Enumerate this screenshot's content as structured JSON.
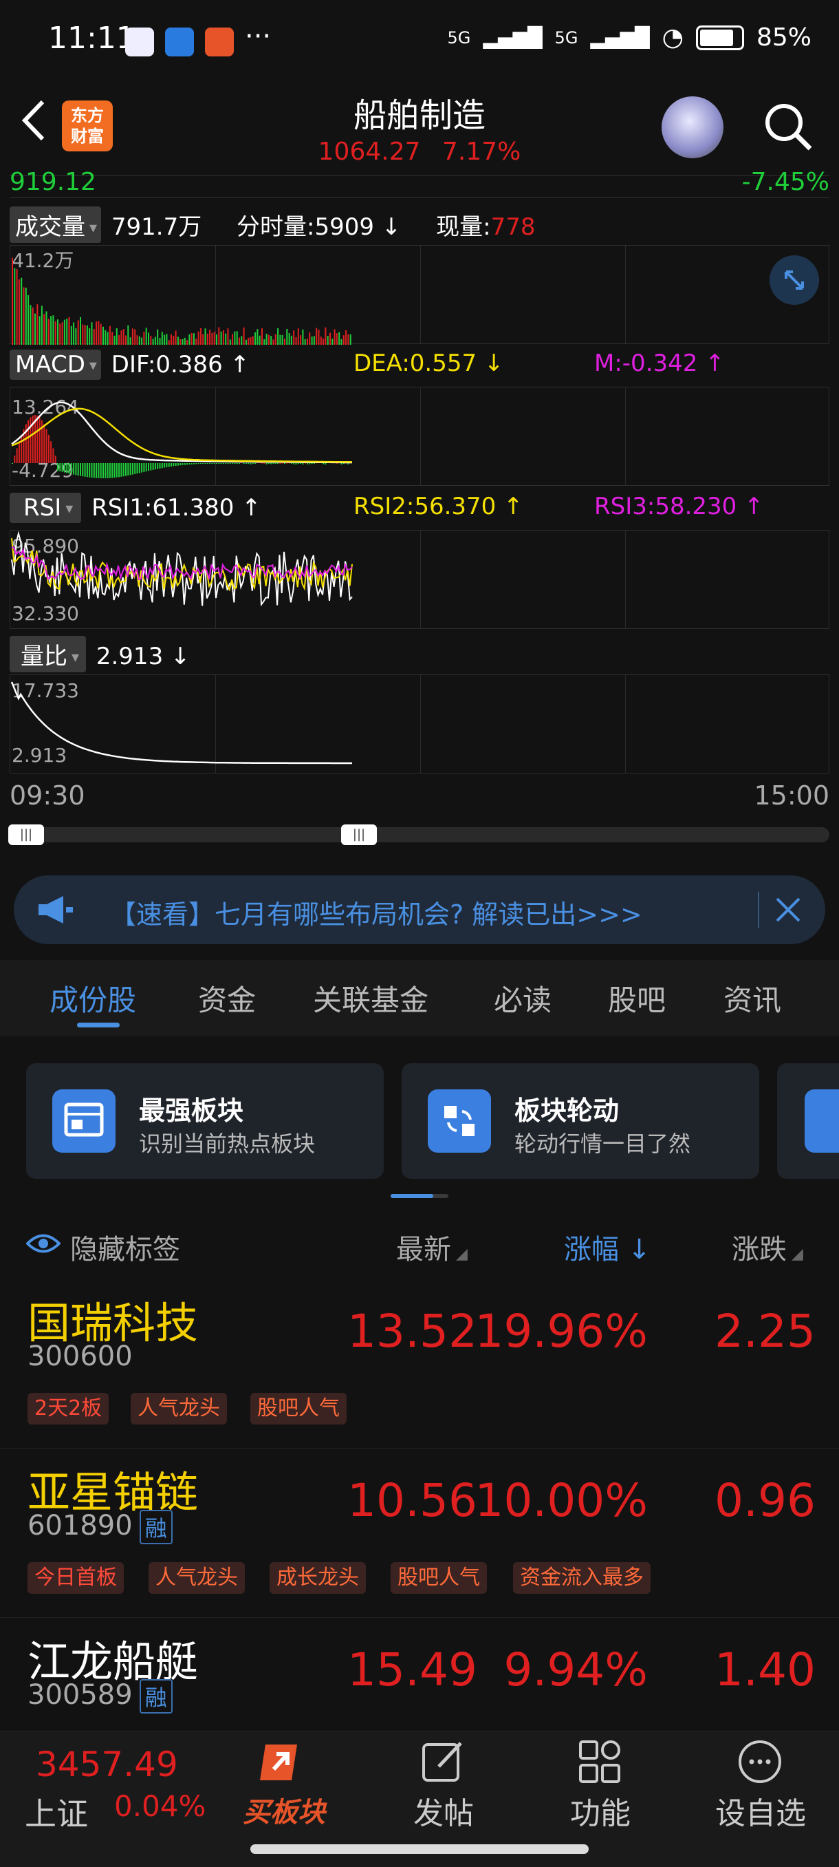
{
  "status": {
    "time": "11:11",
    "battery": "85%",
    "signal1": "5G",
    "signal2": "5G",
    "extra": "···"
  },
  "header": {
    "title": "船舶制造",
    "price": "1064.27",
    "change": "7.17%",
    "logo_text": "东方财富"
  },
  "chart": {
    "top_left_value": "919.12",
    "top_right_value": "-7.45%",
    "volume": {
      "selector": "成交量",
      "value": "791.7万",
      "minute_label": "分时量:5909",
      "minute_arrow": "↓",
      "now_label": "现量:",
      "now_value": "778",
      "axis_max": "41.2万"
    },
    "macd": {
      "selector": "MACD",
      "dif": "DIF:0.386",
      "dif_arrow": "↑",
      "dea": "DEA:0.557",
      "dea_arrow": "↓",
      "m": "M:-0.342",
      "m_arrow": "↑",
      "axis_max": "13.264",
      "axis_min": "-4.729"
    },
    "rsi": {
      "selector": "RSI",
      "rsi1": "RSI1:61.380",
      "rsi1_arrow": "↑",
      "rsi2": "RSI2:56.370",
      "rsi2_arrow": "↑",
      "rsi3": "RSI3:58.230",
      "rsi3_arrow": "↑",
      "axis_max": "95.890",
      "axis_min": "32.330"
    },
    "lb": {
      "selector": "量比",
      "value": "2.913",
      "arrow": "↓",
      "axis_max": "17.733",
      "axis_min": "2.913"
    },
    "time_start": "09:30",
    "time_end": "15:00",
    "colors": {
      "up": "#e02020",
      "down": "#1fcf3a",
      "dif": "#ffffff",
      "dea": "#f5e000",
      "m": "#e020e0"
    }
  },
  "banner": {
    "text": "【速看】七月有哪些布局机会? 解读已出>>>"
  },
  "tabs": [
    "成份股",
    "资金",
    "关联基金",
    "必读",
    "股吧",
    "资讯"
  ],
  "cards": [
    {
      "title": "最强板块",
      "sub": "识别当前热点板块"
    },
    {
      "title": "板块轮动",
      "sub": "轮动行情一目了然"
    }
  ],
  "list_header": {
    "hide": "隐藏标签",
    "latest": "最新",
    "change_pct": "涨幅",
    "change": "涨跌"
  },
  "stocks": [
    {
      "name": "国瑞科技",
      "code": "300600",
      "rong": "",
      "price": "13.52",
      "pct": "19.96%",
      "chg": "2.25",
      "tags": [
        "2天2板",
        "人气龙头",
        "股吧人气"
      ]
    },
    {
      "name": "亚星锚链",
      "code": "601890",
      "rong": "融",
      "price": "10.56",
      "pct": "10.00%",
      "chg": "0.96",
      "tags": [
        "今日首板",
        "人气龙头",
        "成长龙头",
        "股吧人气",
        "资金流入最多"
      ]
    },
    {
      "name": "江龙船艇",
      "code": "300589",
      "rong": "融",
      "price": "15.49",
      "pct": "9.94%",
      "chg": "1.40",
      "tags": []
    }
  ],
  "bottom": {
    "index_value": "3457.49",
    "index_name": "上证",
    "index_change": "0.04%",
    "buy": "买板块",
    "post": "发帖",
    "func": "功能",
    "watch": "设自选"
  }
}
